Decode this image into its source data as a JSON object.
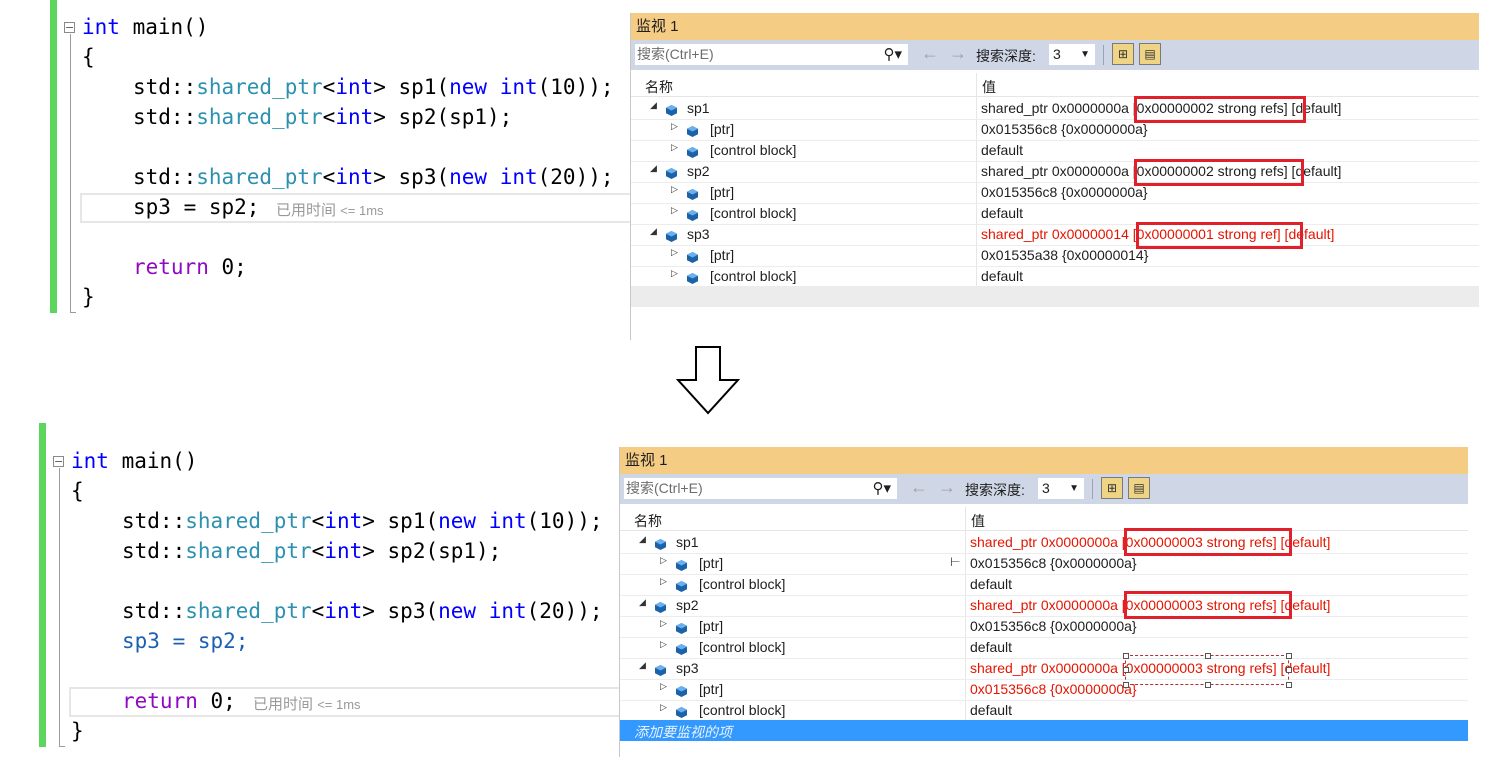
{
  "top": {
    "code": {
      "line1": {
        "kw": "int",
        "rest": " main()"
      },
      "line2": "{",
      "line3": {
        "ns": "std::",
        "type": "shared_ptr",
        "lt": "<",
        "kw": "int",
        "gt": "> sp1(",
        "new": "new",
        "sp": " ",
        "kw2": "int",
        "end": "(10));"
      },
      "line4": {
        "ns": "std::",
        "type": "shared_ptr",
        "lt": "<",
        "kw": "int",
        "gt": "> sp2(sp1);"
      },
      "line6": {
        "ns": "std::",
        "type": "shared_ptr",
        "lt": "<",
        "kw": "int",
        "gt": "> sp3(",
        "new": "new",
        "sp": " ",
        "kw2": "int",
        "end": "(20));"
      },
      "line7": "sp3 = sp2;",
      "elapsed_label": "已用时间",
      "elapsed_value": "<= 1ms",
      "line9": {
        "kw": "return",
        "rest": " 0;"
      },
      "line10": "}"
    },
    "watch": {
      "title": "监视 1",
      "search_placeholder": "搜索(Ctrl+E)",
      "search_icon": "search-icon",
      "depth_label": "搜索深度:",
      "depth_value": "3",
      "col_name": "名称",
      "col_value": "值",
      "rows": [
        {
          "name": "sp1",
          "value": "shared_ptr 0x0000000a [0x00000002 strong refs] [default]",
          "changed": false
        },
        {
          "name": "[ptr]",
          "value": "0x015356c8 {0x0000000a}",
          "changed": false
        },
        {
          "name": "[control block]",
          "value": "default",
          "changed": false
        },
        {
          "name": "sp2",
          "value": "shared_ptr 0x0000000a [0x00000002 strong refs] [default]",
          "changed": false
        },
        {
          "name": "[ptr]",
          "value": "0x015356c8 {0x0000000a}",
          "changed": false
        },
        {
          "name": "[control block]",
          "value": "default",
          "changed": false
        },
        {
          "name": "sp3",
          "value": "shared_ptr 0x00000014 [0x00000001 strong ref] [default]",
          "changed": true
        },
        {
          "name": "[ptr]",
          "value": "0x01535a38 {0x00000014}",
          "changed": false
        },
        {
          "name": "[control block]",
          "value": "default",
          "changed": false
        }
      ]
    }
  },
  "bottom": {
    "code": {
      "line1": {
        "kw": "int",
        "rest": " main()"
      },
      "line2": "{",
      "line3": {
        "ns": "std::",
        "type": "shared_ptr",
        "lt": "<",
        "kw": "int",
        "gt": "> sp1(",
        "new": "new",
        "sp": " ",
        "kw2": "int",
        "end": "(10));"
      },
      "line4": {
        "ns": "std::",
        "type": "shared_ptr",
        "lt": "<",
        "kw": "int",
        "gt": "> sp2(sp1);"
      },
      "line6": {
        "ns": "std::",
        "type": "shared_ptr",
        "lt": "<",
        "kw": "int",
        "gt": "> sp3(",
        "new": "new",
        "sp": " ",
        "kw2": "int",
        "end": "(20));"
      },
      "line7": "sp3 = sp2;",
      "elapsed_label": "已用时间",
      "elapsed_value": "<= 1ms",
      "line9": {
        "kw": "return",
        "rest": " 0;"
      },
      "line10": "}"
    },
    "watch": {
      "title": "监视 1",
      "search_placeholder": "搜索(Ctrl+E)",
      "search_icon": "search-icon",
      "depth_label": "搜索深度:",
      "depth_value": "3",
      "col_name": "名称",
      "col_value": "值",
      "rows": [
        {
          "name": "sp1",
          "value": "shared_ptr 0x0000000a [0x00000003 strong refs] [default]",
          "changed": true
        },
        {
          "name": "[ptr]",
          "value": "0x015356c8 {0x0000000a}",
          "changed": false
        },
        {
          "name": "[control block]",
          "value": "default",
          "changed": false
        },
        {
          "name": "sp2",
          "value": "shared_ptr 0x0000000a [0x00000003 strong refs] [default]",
          "changed": true
        },
        {
          "name": "[ptr]",
          "value": "0x015356c8 {0x0000000a}",
          "changed": false
        },
        {
          "name": "[control block]",
          "value": "default",
          "changed": false
        },
        {
          "name": "sp3",
          "value": "shared_ptr 0x0000000a [0x00000003 strong refs] [default]",
          "changed": true
        },
        {
          "name": "[ptr]",
          "value": "0x015356c8 {0x0000000a}",
          "changed": true
        },
        {
          "name": "[control block]",
          "value": "default",
          "changed": false
        }
      ],
      "add_item": "添加要监视的项"
    }
  },
  "colors": {
    "keyword": "#0000ff",
    "type": "#2b91af",
    "return_kw": "#8f08c4",
    "changed_value": "#e51400",
    "highlight_box": "#e0202a",
    "title_bar": "#f5cc84",
    "toolbar": "#cfd6e5",
    "add_row": "#3399ff",
    "green_margin": "#5cd65c"
  }
}
